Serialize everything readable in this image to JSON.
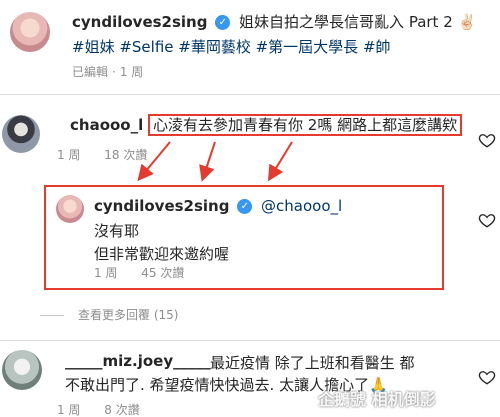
{
  "post": {
    "username": "cyndiloves2sing",
    "caption": "姐妹自拍之學長信哥亂入 Part 2",
    "caption_emoji": "✌🏻",
    "hashtags": "#姐妹 #Selfie #華岡藝校 #第一屆大學長 #帥",
    "edited": "已編輯",
    "time": "1 周"
  },
  "comments": [
    {
      "username": "chaooo_l",
      "text": "心淩有去參加青春有你 2嗎 網路上都這麼講欸",
      "time": "1 周",
      "likes": "18 次讚"
    }
  ],
  "reply": {
    "username": "cyndiloves2sing",
    "mention": "@chaooo_l",
    "line1": "沒有耶",
    "line2": "但非常歡迎來邀約喔",
    "time": "1 周",
    "likes": "45 次讚"
  },
  "view_more": "查看更多回覆 (15)",
  "comment3": {
    "username": "_____miz.joey_____",
    "text": "最近疫情 除了上班和看醫生 都不敢出門了. 希望疫情快快過去. 太讓人擔心了",
    "emoji": "🙏",
    "time": "1 周",
    "likes": "8 次讚"
  },
  "watermark": "企鵝號 相机倒影",
  "colors": {
    "annotation_red": "#e53b2e",
    "verified_blue": "#3897f0",
    "hashtag": "#00376b"
  }
}
